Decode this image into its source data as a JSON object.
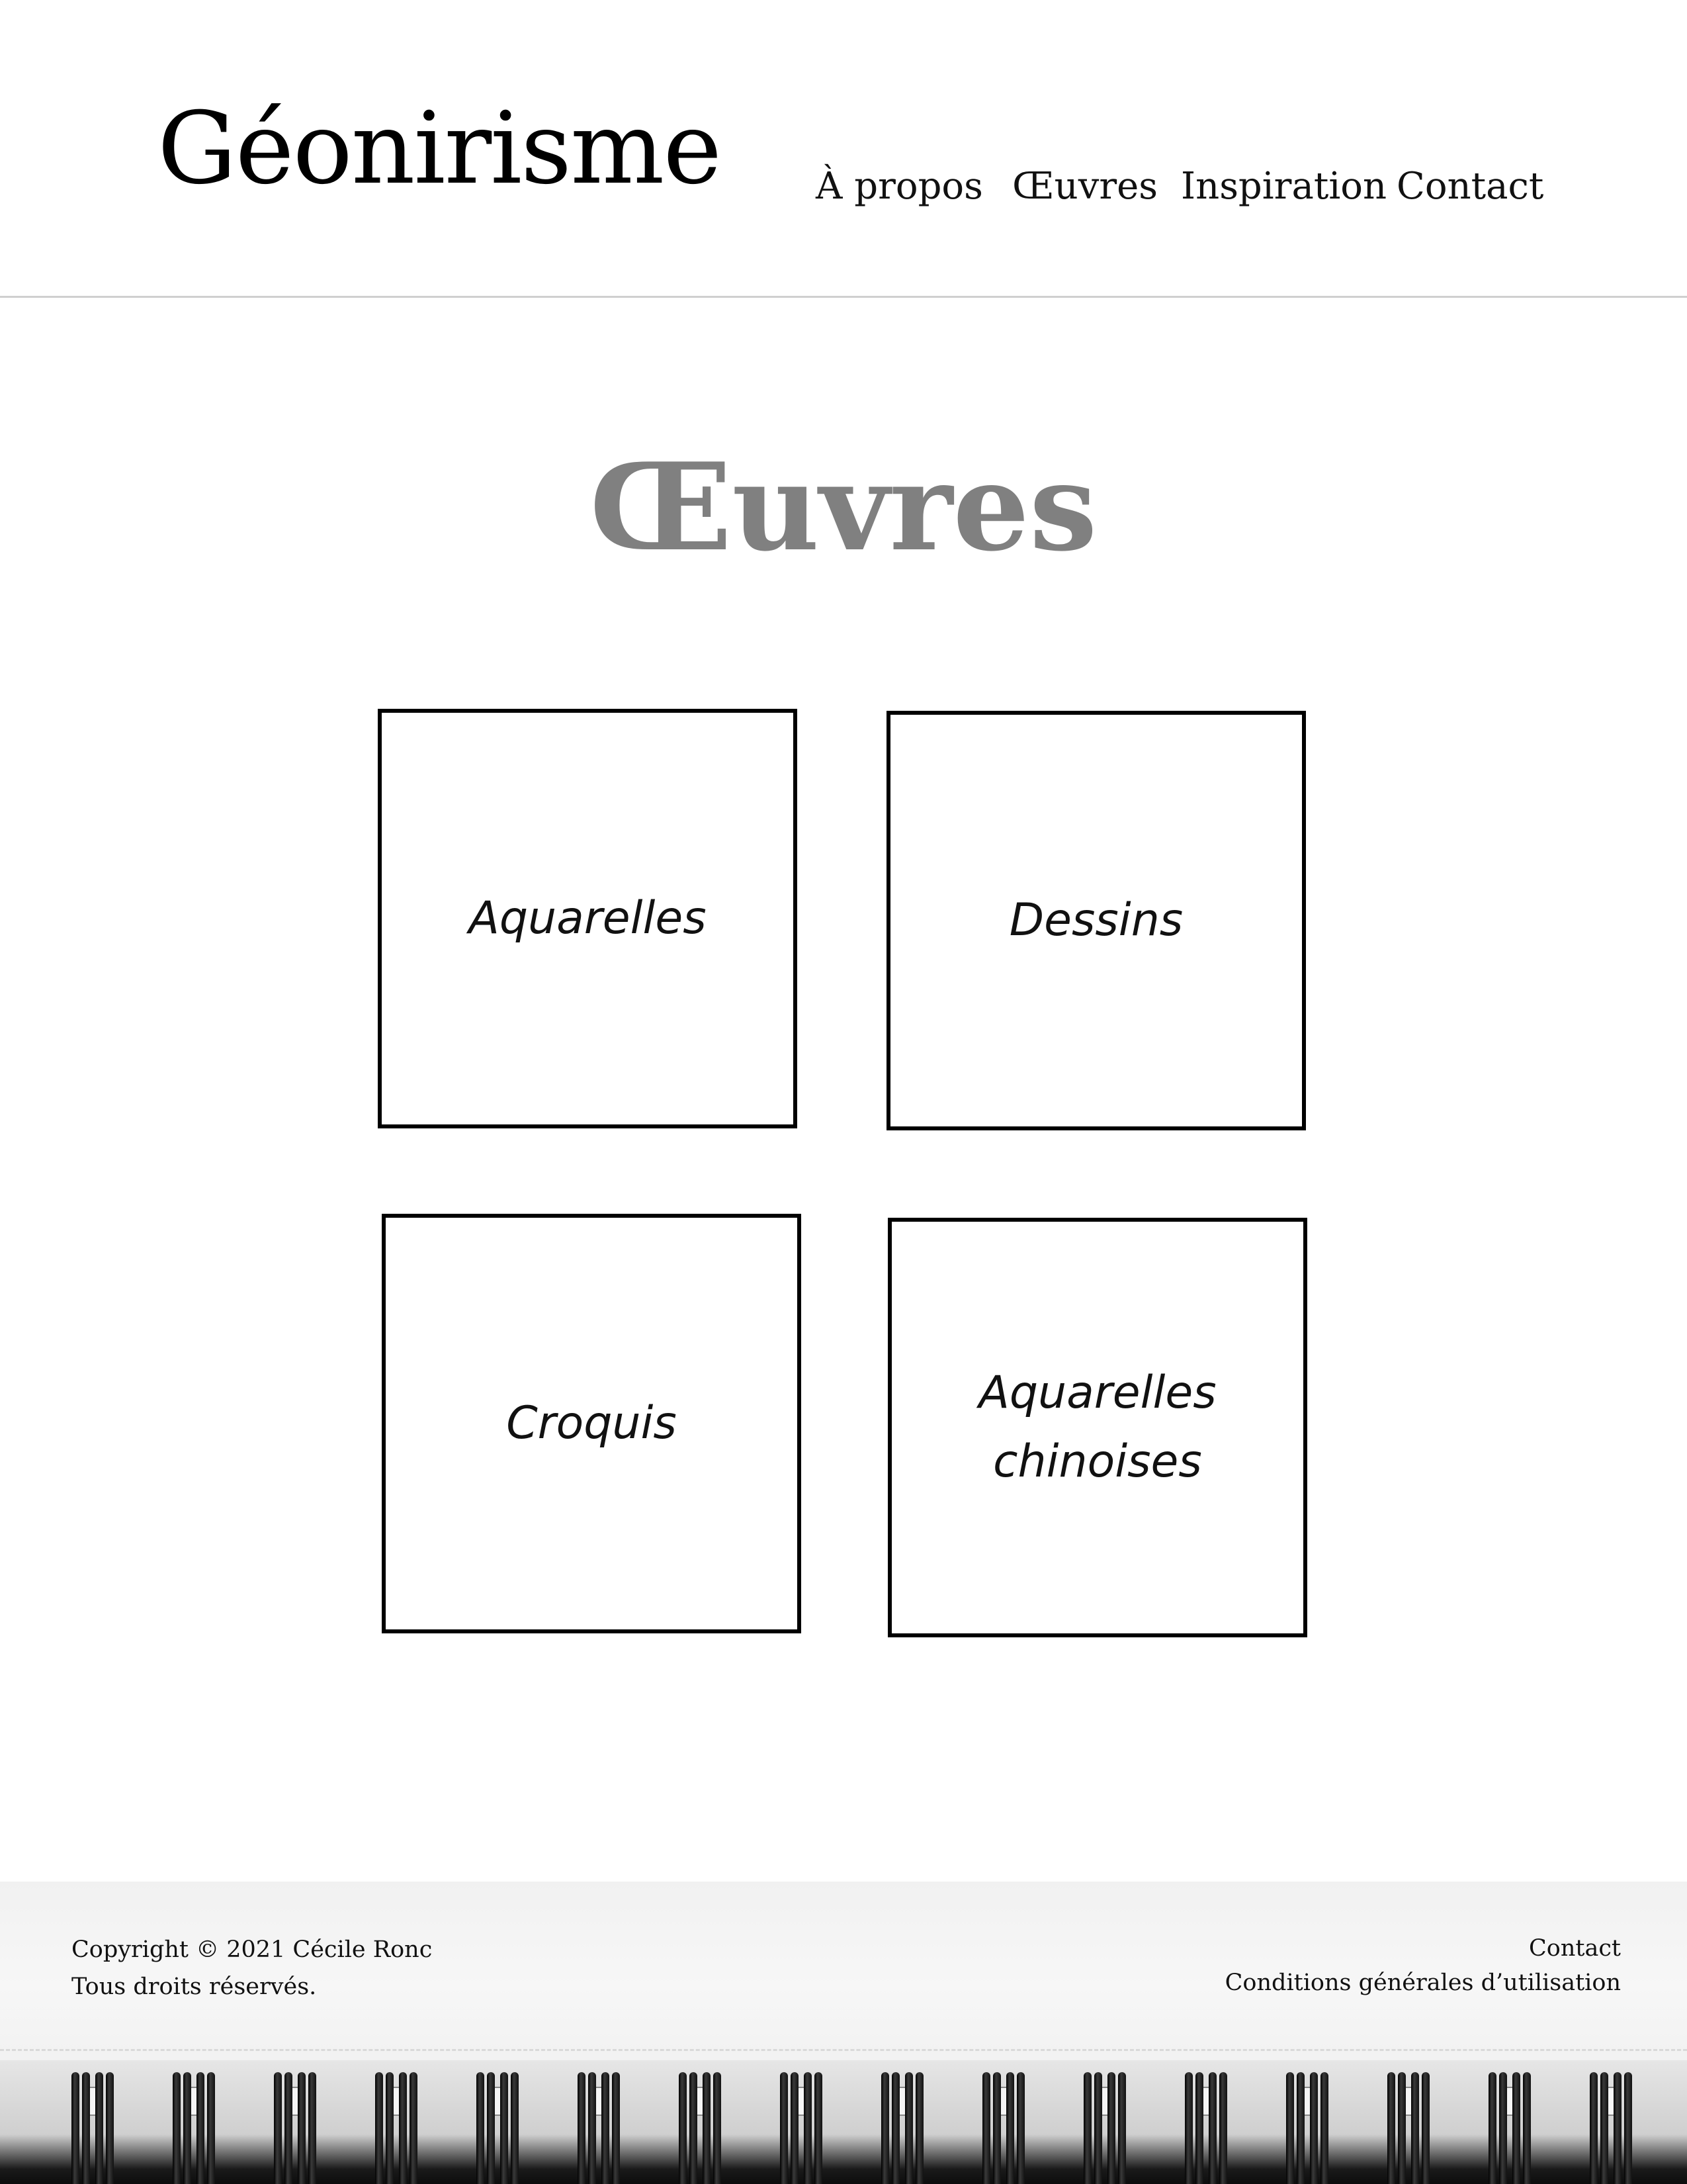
{
  "header": {
    "logo": "Géonirisme",
    "nav": [
      {
        "label": "À propos"
      },
      {
        "label": "Œuvres"
      },
      {
        "label": "Inspiration"
      },
      {
        "label": "Contact"
      }
    ]
  },
  "main": {
    "title": "Œuvres",
    "cards": [
      {
        "label": "Aquarelles"
      },
      {
        "label": "Dessins"
      },
      {
        "label": "Croquis"
      },
      {
        "label": "Aquarelles chinoises"
      }
    ]
  },
  "footer": {
    "copyright": "Copyright © 2021 Cécile Ronc",
    "rights": "Tous droits réservés.",
    "links": [
      {
        "label": "Contact"
      },
      {
        "label": "Conditions générales d’utilisation"
      }
    ]
  },
  "colors": {
    "title": "#808080",
    "text": "#111111",
    "divider": "#cfcfcf",
    "card_border": "#000000"
  }
}
